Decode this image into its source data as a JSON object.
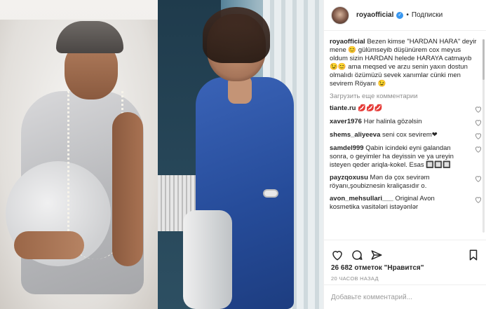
{
  "header": {
    "username": "royaofficial",
    "verified_symbol": "✓",
    "separator": "•",
    "follow_label": "Подписки"
  },
  "caption": {
    "username": "royaofficial",
    "text": "Bezen kimse \"HARDAN HARA\" deyir mene 😊 gülümseyib düşünürem cox meyus oldum sizin HARDAN helede HARAYA catmayıb 😉😊 ama meqsed ve arzu senin yaxın dostun olmalıdı özümüzü sevek xanımlar cünki men sevirem Röyanı 😉"
  },
  "load_more": "Загрузить еще комментарии",
  "comments": [
    {
      "username": "tiante.ru",
      "text": "💋💋💋"
    },
    {
      "username": "xaver1976",
      "text": "Hər halinla gözəlsin"
    },
    {
      "username": "shems_aliyeeva",
      "text": "seni cox sevirem❤"
    },
    {
      "username": "samdel999",
      "text": "Qabin icindeki eyni galandan sonra, o geyimler ha deyissin ve ya ureyin isteyen qeder ariqla-kokel. Esas 🔲🔲🔲"
    },
    {
      "username": "payzqoxusu",
      "text": "Mən də çox sevirəm röyanı,şoubiznesin kraliçasıdır o."
    },
    {
      "username": "avon_mehsullari___",
      "text": "Original Avon kosmetika vasitələri istəyənlər"
    }
  ],
  "likes": {
    "count": "26 682",
    "label_before": "отметок",
    "label_after": "\"Нравится\""
  },
  "time": "20 ЧАСОВ НАЗАД",
  "add_comment": {
    "placeholder": "Добавьте комментарий..."
  },
  "colors": {
    "accent": "#3897f0",
    "text": "#262626",
    "muted": "#8e8e8e",
    "border": "#efefef"
  }
}
